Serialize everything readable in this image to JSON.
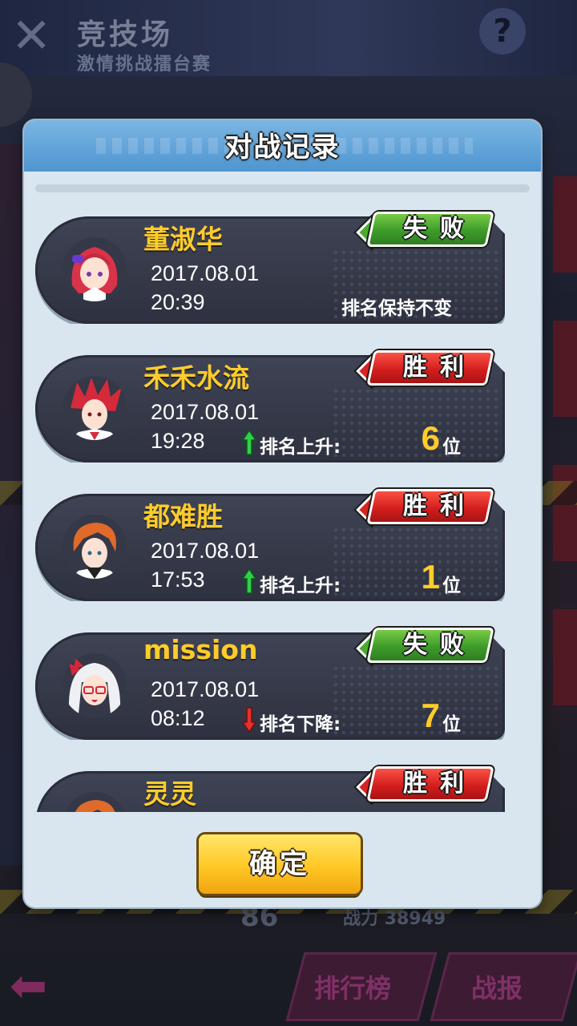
{
  "background": {
    "title": "竞技场",
    "subtitle": "激情挑战擂台赛",
    "help_label": "?",
    "bottom_buttons": [
      "排行榜",
      "战报"
    ],
    "bottom_number": "86",
    "bottom_power": "战力 38949"
  },
  "dialog": {
    "title": "对战记录",
    "confirm_label": "确定"
  },
  "records": [
    {
      "name": "董淑华",
      "date": "2017.08.01",
      "time": "20:39",
      "result": "失败",
      "result_type": "lose",
      "status_text": "排名保持不变",
      "avatar": "red-hair-girl-avatar"
    },
    {
      "name": "禾禾水流",
      "date": "2017.08.01",
      "time": "19:28",
      "result": "胜利",
      "result_type": "win",
      "rank_label": "排名上升:",
      "rank_change": "6",
      "rank_unit": "位",
      "direction": "up",
      "avatar": "spiky-red-hair-boy-avatar"
    },
    {
      "name": "都难胜",
      "date": "2017.08.01",
      "time": "17:53",
      "result": "胜利",
      "result_type": "win",
      "rank_label": "排名上升:",
      "rank_change": "1",
      "rank_unit": "位",
      "direction": "up",
      "avatar": "orange-hair-boy-avatar"
    },
    {
      "name": "mission",
      "date": "2017.08.01",
      "time": "08:12",
      "result": "失败",
      "result_type": "lose",
      "rank_label": "排名下降:",
      "rank_change": "7",
      "rank_unit": "位",
      "direction": "down",
      "avatar": "white-hair-glasses-girl-avatar"
    },
    {
      "name": "灵灵",
      "result": "胜利",
      "result_type": "win",
      "avatar": "orange-hair-boy-avatar"
    }
  ],
  "colors": {
    "name": "#ffcc2a",
    "win": "#d41e1e",
    "lose": "#3d9a2a",
    "header": "#4f95cf",
    "arrow_up": "#2fd14a",
    "arrow_down": "#e8302a"
  }
}
